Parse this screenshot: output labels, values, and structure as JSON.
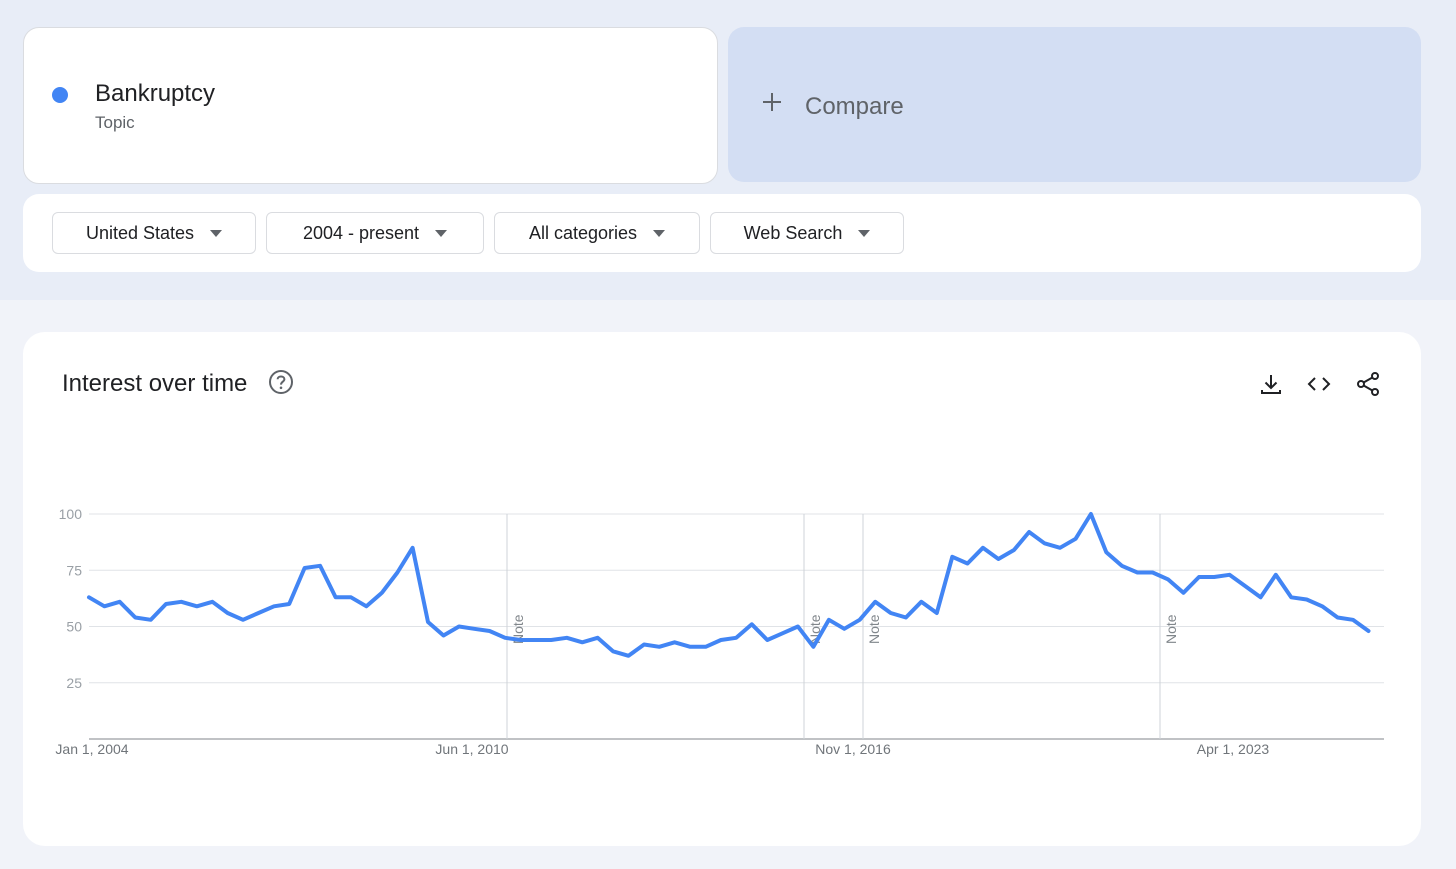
{
  "search_term": {
    "name": "Bankruptcy",
    "type": "Topic",
    "color": "#4285f4"
  },
  "compare": {
    "label": "Compare"
  },
  "filters": [
    {
      "label": "United States"
    },
    {
      "label": "2004 - present"
    },
    {
      "label": "All categories"
    },
    {
      "label": "Web Search"
    }
  ],
  "chart_header": {
    "title": "Interest over time"
  },
  "icons": [
    "help-icon",
    "download-icon",
    "embed-icon",
    "share-icon"
  ],
  "chart_data": {
    "type": "line",
    "title": "Interest over time",
    "xlabel": "",
    "ylabel": "",
    "x_range": [
      "2004-01-01",
      "2025-01-01"
    ],
    "ylim": [
      0,
      100
    ],
    "y_ticks": [
      "100",
      "75",
      "50",
      "25"
    ],
    "x_tick_labels": [
      "Jan 1, 2004",
      "Jun 1, 2010",
      "Nov 1, 2016",
      "Apr 1, 2023"
    ],
    "annotations": [
      "Note",
      "Note",
      "Note",
      "Note"
    ],
    "grid": true,
    "legend": "none",
    "series": [
      {
        "color": "#4285f4",
        "points": [
          [
            "2004-01-01",
            63
          ],
          [
            "2004-04-01",
            59
          ],
          [
            "2004-07-01",
            61
          ],
          [
            "2004-10-01",
            54
          ],
          [
            "2005-01-01",
            53
          ],
          [
            "2005-04-01",
            60
          ],
          [
            "2005-07-01",
            61
          ],
          [
            "2005-10-01",
            59
          ],
          [
            "2006-01-01",
            61
          ],
          [
            "2006-04-01",
            56
          ],
          [
            "2006-07-01",
            53
          ],
          [
            "2006-10-01",
            56
          ],
          [
            "2007-01-01",
            59
          ],
          [
            "2007-04-01",
            60
          ],
          [
            "2007-07-01",
            76
          ],
          [
            "2007-10-01",
            77
          ],
          [
            "2008-01-01",
            63
          ],
          [
            "2008-04-01",
            63
          ],
          [
            "2008-07-01",
            59
          ],
          [
            "2008-10-01",
            65
          ],
          [
            "2009-01-01",
            74
          ],
          [
            "2009-04-01",
            85
          ],
          [
            "2009-07-01",
            52
          ],
          [
            "2009-10-01",
            46
          ],
          [
            "2010-01-01",
            50
          ],
          [
            "2010-04-01",
            49
          ],
          [
            "2010-07-01",
            48
          ],
          [
            "2010-10-01",
            45
          ],
          [
            "2011-01-01",
            44
          ],
          [
            "2011-04-01",
            44
          ],
          [
            "2011-07-01",
            44
          ],
          [
            "2011-10-01",
            45
          ],
          [
            "2012-01-01",
            43
          ],
          [
            "2012-04-01",
            45
          ],
          [
            "2012-07-01",
            39
          ],
          [
            "2012-10-01",
            37
          ],
          [
            "2013-01-01",
            42
          ],
          [
            "2013-04-01",
            41
          ],
          [
            "2013-07-01",
            43
          ],
          [
            "2013-10-01",
            41
          ],
          [
            "2014-01-01",
            41
          ],
          [
            "2014-04-01",
            44
          ],
          [
            "2014-07-01",
            45
          ],
          [
            "2014-10-01",
            51
          ],
          [
            "2015-01-01",
            44
          ],
          [
            "2015-04-01",
            47
          ],
          [
            "2015-07-01",
            50
          ],
          [
            "2015-10-01",
            41
          ],
          [
            "2016-01-01",
            53
          ],
          [
            "2016-04-01",
            49
          ],
          [
            "2016-07-01",
            53
          ],
          [
            "2016-10-01",
            61
          ],
          [
            "2017-01-01",
            56
          ],
          [
            "2017-04-01",
            54
          ],
          [
            "2017-07-01",
            61
          ],
          [
            "2017-10-01",
            56
          ],
          [
            "2018-01-01",
            81
          ],
          [
            "2018-04-01",
            78
          ],
          [
            "2018-07-01",
            85
          ],
          [
            "2018-10-01",
            80
          ],
          [
            "2019-01-01",
            84
          ],
          [
            "2019-04-01",
            92
          ],
          [
            "2019-07-01",
            87
          ],
          [
            "2019-10-01",
            85
          ],
          [
            "2020-01-01",
            89
          ],
          [
            "2020-04-01",
            100
          ],
          [
            "2020-07-01",
            83
          ],
          [
            "2020-10-01",
            77
          ],
          [
            "2021-01-01",
            74
          ],
          [
            "2021-04-01",
            74
          ],
          [
            "2021-07-01",
            71
          ],
          [
            "2021-10-01",
            65
          ],
          [
            "2022-01-01",
            72
          ],
          [
            "2022-04-01",
            72
          ],
          [
            "2022-07-01",
            73
          ],
          [
            "2022-10-01",
            68
          ],
          [
            "2023-01-01",
            63
          ],
          [
            "2023-04-01",
            73
          ],
          [
            "2023-07-01",
            63
          ],
          [
            "2023-10-01",
            62
          ],
          [
            "2024-01-01",
            59
          ],
          [
            "2024-04-01",
            54
          ],
          [
            "2024-07-01",
            53
          ],
          [
            "2024-10-01",
            48
          ]
        ]
      }
    ]
  }
}
